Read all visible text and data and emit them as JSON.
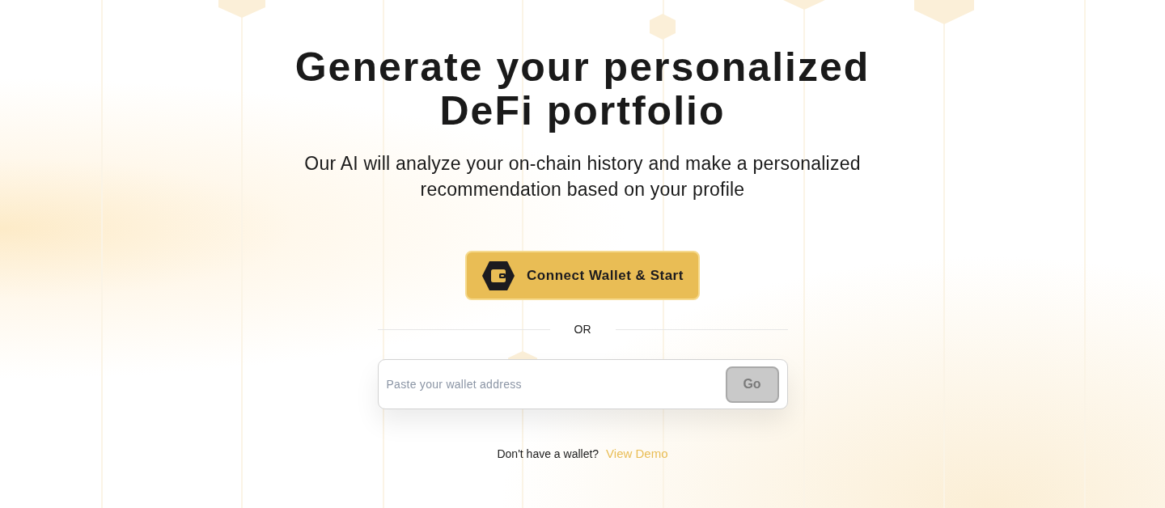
{
  "hero": {
    "title_lines": [
      "Generate your personalized",
      "DeFi portfolio"
    ],
    "subtitle_lines": [
      "Our AI will analyze your on-chain history and make a personalized",
      "recommendation based on your profile"
    ]
  },
  "connect_button": {
    "label": "Connect Wallet & Start"
  },
  "divider": {
    "label": "OR"
  },
  "address_form": {
    "placeholder": "Paste your wallet address",
    "submit": {
      "label": "Go",
      "disabled": true
    }
  },
  "footer": {
    "prompt": "Don't have a wallet?",
    "link": "View Demo"
  }
}
